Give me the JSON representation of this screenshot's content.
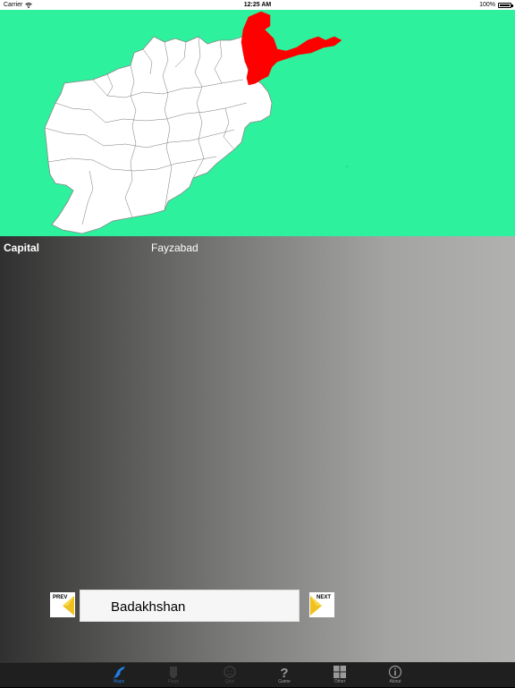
{
  "status": {
    "carrier": "Carrier",
    "time": "12:25 AM",
    "battery": "100%"
  },
  "map": {
    "selected_province": "Badakhshan",
    "highlight_color": "#ff0000",
    "background_color": "#2df19d"
  },
  "info": {
    "capital_label": "Capital",
    "capital_value": "Fayzabad"
  },
  "nav": {
    "prev_label": "PREV",
    "next_label": "NEXT",
    "current": "Badakhshan"
  },
  "tabs": [
    {
      "label": "Maps",
      "icon": "map-icon",
      "active": true
    },
    {
      "label": "Flags",
      "icon": "flag-icon",
      "active": false
    },
    {
      "label": "Quiz",
      "icon": "quiz-icon",
      "active": false
    },
    {
      "label": "Game",
      "icon": "question-icon",
      "active": false
    },
    {
      "label": "Other",
      "icon": "grid-icon",
      "active": false
    },
    {
      "label": "About",
      "icon": "info-icon",
      "active": false
    }
  ]
}
